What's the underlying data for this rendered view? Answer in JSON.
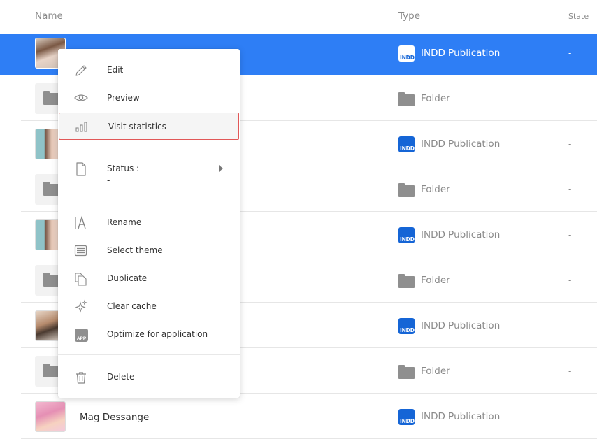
{
  "header": {
    "name_label": "Name",
    "type_label": "Type",
    "state_label": "State"
  },
  "rows": [
    {
      "kind": "indd",
      "name": "",
      "type": "INDD Publication",
      "state": "-",
      "selected": true,
      "thumb": "photo"
    },
    {
      "kind": "folder",
      "name": "",
      "type": "Folder",
      "state": "-"
    },
    {
      "kind": "indd",
      "name": "",
      "type": "INDD Publication",
      "state": "-",
      "thumb": "teal"
    },
    {
      "kind": "folder",
      "name": "",
      "type": "Folder",
      "state": "-"
    },
    {
      "kind": "indd",
      "name": "",
      "type": "INDD Publication",
      "state": "-",
      "thumb": "teal"
    },
    {
      "kind": "folder",
      "name": "",
      "type": "Folder",
      "state": "-"
    },
    {
      "kind": "indd",
      "name": "",
      "type": "INDD Publication",
      "state": "-",
      "thumb": "sun"
    },
    {
      "kind": "folder",
      "name": "",
      "type": "Folder",
      "state": "-"
    },
    {
      "kind": "indd",
      "name": "Mag Dessange",
      "type": "INDD Publication",
      "state": "-",
      "thumb": "pink"
    }
  ],
  "indd_badge": "INDD",
  "context_menu": {
    "edit": "Edit",
    "preview": "Preview",
    "visit_statistics": "Visit statistics",
    "status_label": "Status :",
    "status_value": "-",
    "rename": "Rename",
    "select_theme": "Select theme",
    "duplicate": "Duplicate",
    "clear_cache": "Clear cache",
    "optimize": "Optimize for application",
    "app_badge": "APP",
    "delete": "Delete"
  },
  "colors": {
    "selection": "#2e7ef5",
    "indd_blue": "#1565d6",
    "hover_outline": "#e15757"
  }
}
